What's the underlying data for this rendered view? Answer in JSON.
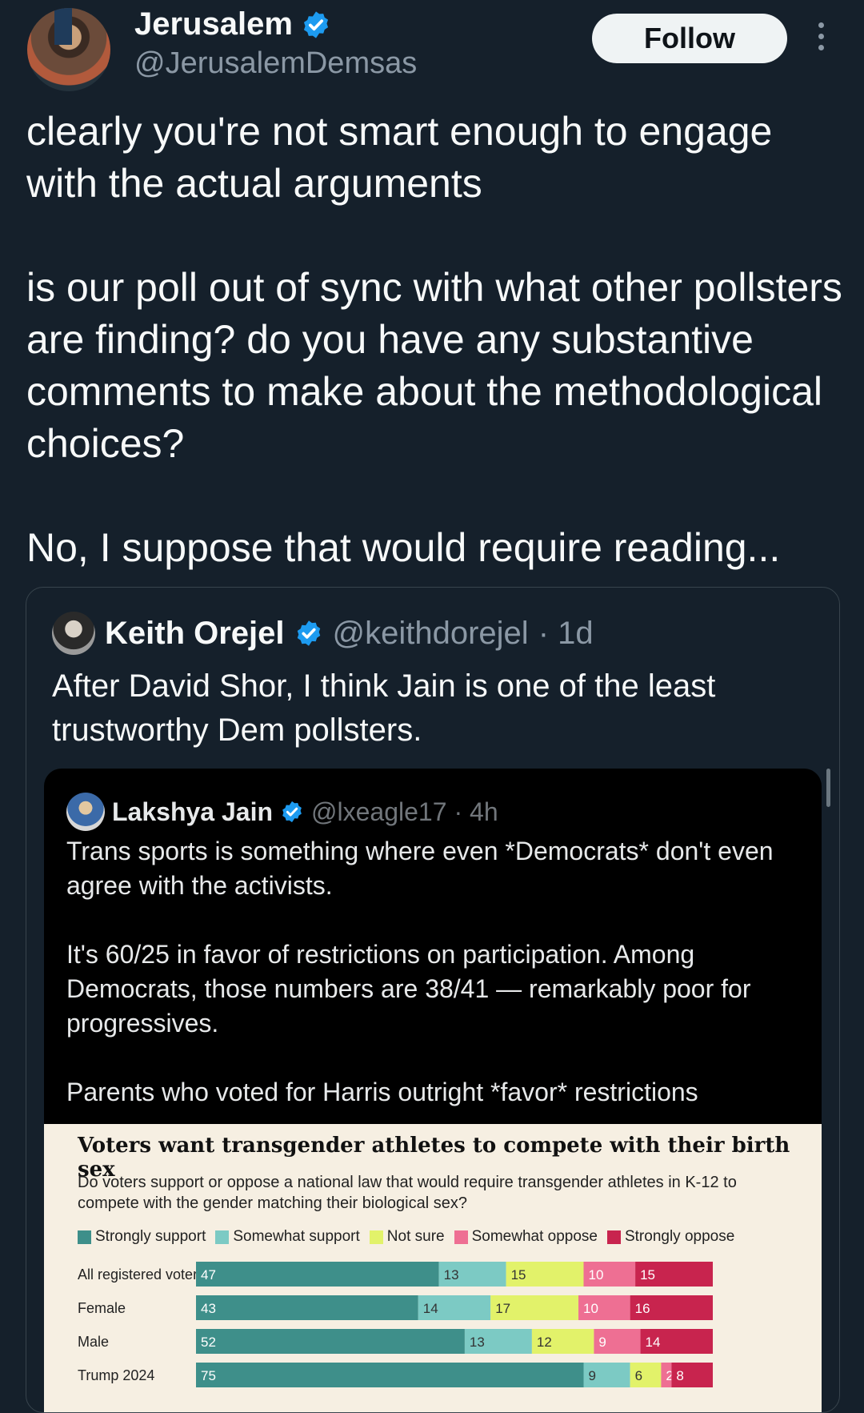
{
  "author": {
    "name": "Jerusalem",
    "handle": "@JerusalemDemsas",
    "follow_label": "Follow"
  },
  "tweet": {
    "paragraphs": [
      "clearly you're not smart enough to engage with the actual arguments",
      "is our poll out of sync with what other pollsters are finding? do you have any substantive comments to make about the methodological choices?",
      "No, I suppose that would require reading..."
    ]
  },
  "quote": {
    "name": "Keith Orejel",
    "handle": "@keithdorejel",
    "time": "· 1d",
    "text": "After David Shor, I think Jain is one of the least trustworthy Dem pollsters."
  },
  "inner_quote": {
    "name": "Lakshya Jain",
    "handle": "@lxeagle17",
    "time": "· 4h",
    "paragraphs": [
      "Trans sports is something where even *Democrats* don't even agree with the activists.",
      "It's 60/25 in favor of restrictions on participation. Among Democrats, those numbers are 38/41 — remarkably poor for progressives.",
      "Parents who voted for Harris outright *favor* restrictions"
    ]
  },
  "colors": {
    "verified": "#1d9bf0",
    "strongly_support": "#3e8f8a",
    "somewhat_support": "#7ccac4",
    "not_sure": "#e2f26a",
    "somewhat_oppose": "#ee6f93",
    "strongly_oppose": "#c8244e"
  },
  "chart_data": {
    "type": "bar",
    "orientation": "horizontal",
    "stacked": true,
    "title": "Voters want transgender athletes to compete with their birth sex",
    "subtitle": "Do voters support or oppose a national law that would require transgender athletes in K-12 to compete with the gender matching their biological sex?",
    "categories": [
      "All registered voters",
      "Female",
      "Male",
      "Trump 2024"
    ],
    "series": [
      {
        "name": "Strongly support",
        "values": [
          47,
          43,
          52,
          75
        ]
      },
      {
        "name": "Somewhat support",
        "values": [
          13,
          14,
          13,
          9
        ]
      },
      {
        "name": "Not sure",
        "values": [
          15,
          17,
          12,
          6
        ]
      },
      {
        "name": "Somewhat oppose",
        "values": [
          10,
          10,
          9,
          2
        ]
      },
      {
        "name": "Strongly oppose",
        "values": [
          15,
          16,
          14,
          8
        ]
      }
    ],
    "xlim": [
      0,
      100
    ],
    "legend_position": "top",
    "grid": false
  }
}
